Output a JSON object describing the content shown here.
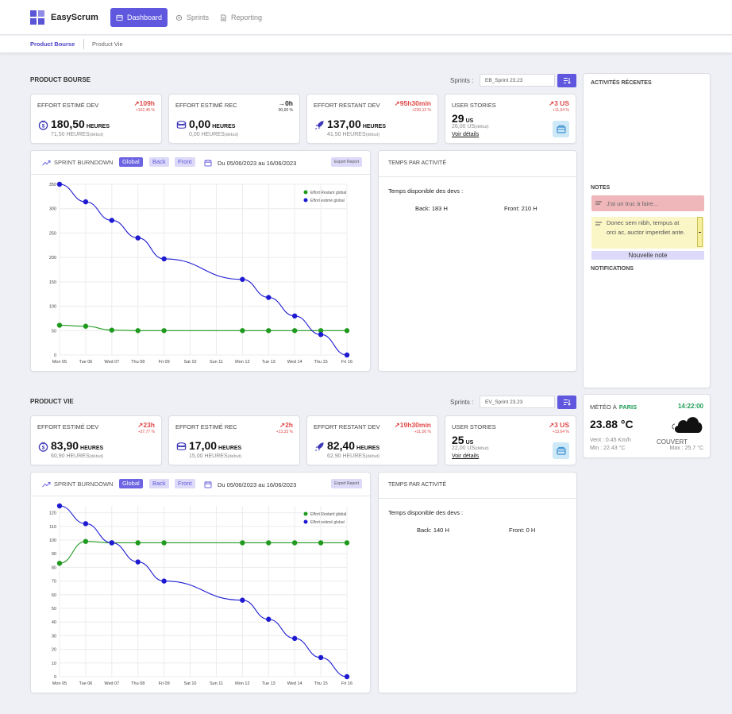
{
  "app": {
    "name": "EasyScrum"
  },
  "nav": {
    "dashboard": "Dashboard",
    "sprints": "Sprints",
    "reporting": "Reporting"
  },
  "subnav": {
    "product_bourse": "Product Bourse",
    "product_vie": "Product Vie"
  },
  "products": [
    {
      "title": "PRODUCT BOURSE",
      "sprint_label": "Sprints :",
      "sprint_value": "EB_Sprint 23.23",
      "kpis": [
        {
          "title": "EFFORT ESTIMÉ DEV",
          "delta": "109h",
          "pct": "+152,45 %",
          "value": "180,50",
          "unit": "HEURES",
          "prev": "71,50 HEURES",
          "prev_suffix": "(début)",
          "icon": "dollar-icon"
        },
        {
          "title": "EFFORT ESTIMÉ REC",
          "delta": "0h",
          "pct": "00,00 %",
          "value": "0,00",
          "unit": "HEURES",
          "prev": "0,00 HEURES",
          "prev_suffix": "(début)",
          "icon": "drum-icon"
        },
        {
          "title": "EFFORT RESTANT DEV",
          "delta": "95h30min",
          "pct": "+230,12 %",
          "value": "137,00",
          "unit": "HEURES",
          "prev": "41,50 HEURES",
          "prev_suffix": "(début)",
          "icon": "rocket-icon"
        }
      ],
      "us": {
        "title": "USER STORIES",
        "delta": "3 US",
        "pct": "+11,54 %",
        "value": "29",
        "unit": "US",
        "prev": "26,00 US",
        "prev_suffix": "(début)",
        "link": "Voir détails"
      },
      "burndown": {
        "title": "SPRINT BURNDOWN",
        "chips": [
          "Global",
          "Back",
          "Front"
        ],
        "date_range": "Du 05/06/2023 au 16/06/2023",
        "export": "Export Report"
      },
      "tpa": {
        "title": "TEMPS PAR ACTIVITÉ",
        "subtitle": "Temps disponible des devs :",
        "back": "Back: 183 H",
        "front": "Front: 210 H"
      }
    },
    {
      "title": "PRODUCT VIE",
      "sprint_label": "Sprints :",
      "sprint_value": "EV_Sprint 23.23",
      "kpis": [
        {
          "title": "EFFORT ESTIMÉ DEV",
          "delta": "23h",
          "pct": "+37,77 %",
          "value": "83,90",
          "unit": "HEURES",
          "prev": "60,90 HEURES",
          "prev_suffix": "(début)",
          "icon": "dollar-icon"
        },
        {
          "title": "EFFORT ESTIMÉ REC",
          "delta": "2h",
          "pct": "+13,33 %",
          "value": "17,00",
          "unit": "HEURES",
          "prev": "15,00 HEURES",
          "prev_suffix": "(début)",
          "icon": "drum-icon"
        },
        {
          "title": "EFFORT RESTANT DEV",
          "delta": "19h30min",
          "pct": "+31,00 %",
          "value": "82,40",
          "unit": "HEURES",
          "prev": "62,90 HEURES",
          "prev_suffix": "(début)",
          "icon": "rocket-icon"
        }
      ],
      "us": {
        "title": "USER STORIES",
        "delta": "3 US",
        "pct": "+13,64 %",
        "value": "25",
        "unit": "US",
        "prev": "22,00 US",
        "prev_suffix": "(début)",
        "link": "Voir détails"
      },
      "burndown": {
        "title": "SPRINT BURNDOWN",
        "chips": [
          "Global",
          "Back",
          "Front"
        ],
        "date_range": "Du 05/06/2023 au 16/06/2023",
        "export": "Export Report"
      },
      "tpa": {
        "title": "TEMPS PAR ACTIVITÉ",
        "subtitle": "Temps disponible des devs :",
        "back": "Back: 140 H",
        "front": "Front: 0 H"
      }
    }
  ],
  "chart_data": [
    {
      "type": "line",
      "categories": [
        "Mon 05",
        "Tue 06",
        "Wed 07",
        "Thu 08",
        "Fri 09",
        "Sat 10",
        "Sun 11",
        "Mon 12",
        "Tue 13",
        "Wed 14",
        "Thu 15",
        "Fri 16"
      ],
      "series": [
        {
          "name": "Effort Restant global",
          "color": "#1f9a1f",
          "values": [
            61,
            59,
            51,
            50,
            50,
            null,
            null,
            50,
            50,
            50,
            50,
            50
          ]
        },
        {
          "name": "Effort estimé global",
          "color": "#1d1ad2",
          "values": [
            350,
            314,
            276,
            240,
            197,
            null,
            null,
            155,
            118,
            80,
            42,
            0
          ]
        }
      ],
      "ylim": [
        0,
        350
      ],
      "yticks": [
        0,
        50,
        100,
        150,
        200,
        250,
        300,
        350
      ],
      "legend": "top-right",
      "grid": true
    },
    {
      "type": "line",
      "categories": [
        "Mon 05",
        "Tue 06",
        "Wed 07",
        "Thu 08",
        "Fri 09",
        "Sat 10",
        "Sun 11",
        "Mon 12",
        "Tue 13",
        "Wed 14",
        "Thu 15",
        "Fri 16"
      ],
      "series": [
        {
          "name": "Effort Restant global",
          "color": "#1f9a1f",
          "values": [
            83,
            99,
            98,
            98,
            98,
            null,
            null,
            98,
            98,
            98,
            98,
            98
          ]
        },
        {
          "name": "Effort estimé global",
          "color": "#1d1ad2",
          "values": [
            125,
            112,
            98,
            84,
            70,
            null,
            null,
            56,
            42,
            28,
            14,
            0
          ]
        }
      ],
      "ylim": [
        0,
        125
      ],
      "yticks": [
        0,
        10,
        20,
        30,
        40,
        50,
        60,
        70,
        80,
        90,
        100,
        110,
        120
      ],
      "legend": "top-right",
      "grid": true
    }
  ],
  "sidebar": {
    "recent_title": "ACTIVITÉS RÉCENTES",
    "notes_title": "NOTES",
    "notes": [
      {
        "text": "J'ai un truc à faire...",
        "color": "#f0b7ba"
      },
      {
        "text": "Donec sem nibh, tempus at orci ac, auctor imperdiet ante.",
        "color": "#fbf6c6"
      }
    ],
    "new_note": "Nouvelle note",
    "notifications_title": "NOTIFICATIONS"
  },
  "weather": {
    "label": "MÉTÉO À",
    "city": "PARIS",
    "time": "14:22:00",
    "temp": "23.88 °C",
    "condition": "COUVERT",
    "wind": "Vent : 0.45 Km/h",
    "min": "Min : 22.43 °C",
    "max": "Max : 25.7 °C",
    "icon": "cloud-icon"
  }
}
